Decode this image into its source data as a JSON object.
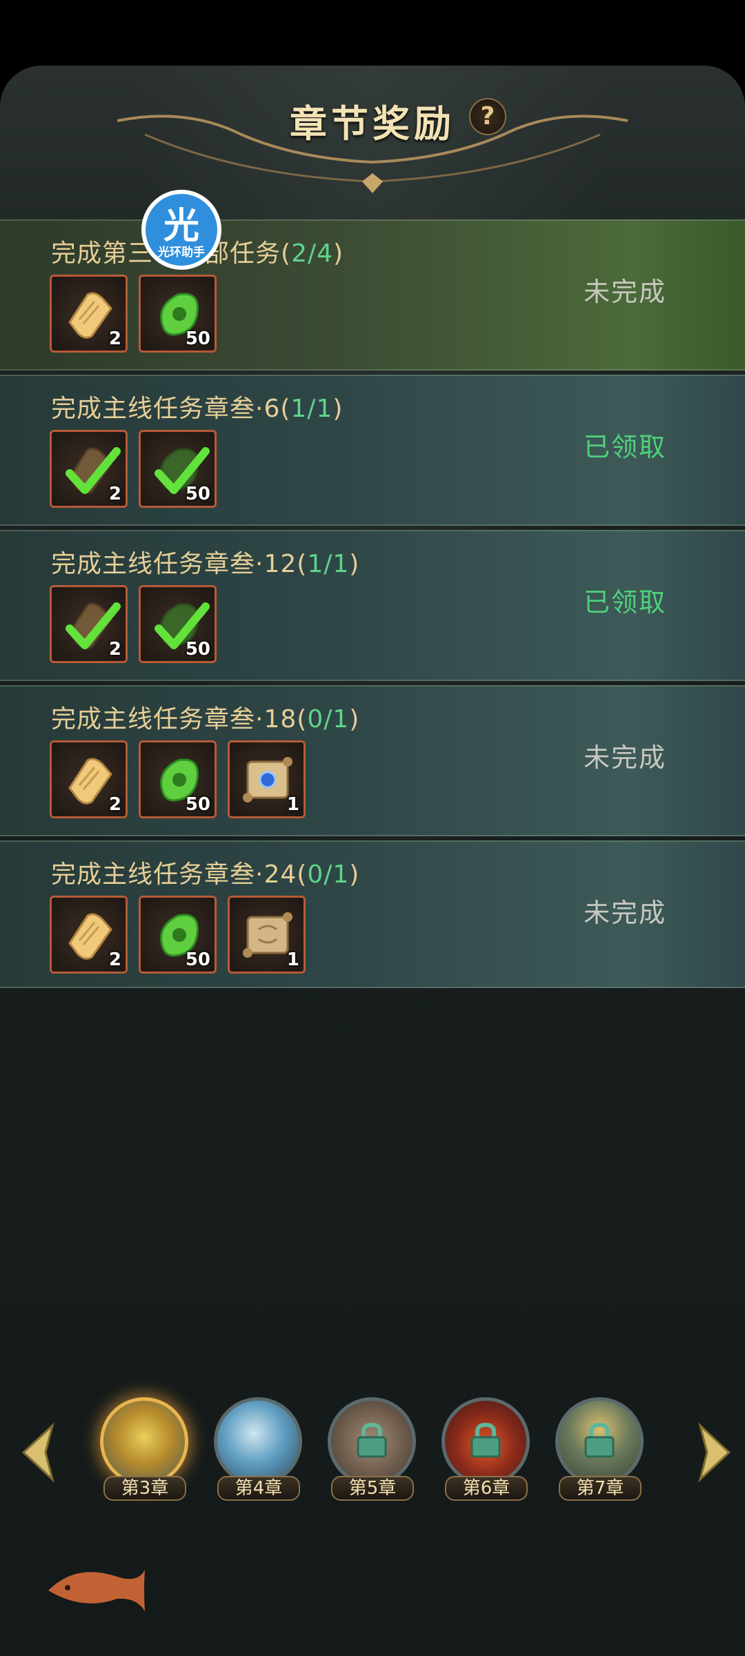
{
  "header": {
    "title": "章节奖励",
    "help_label": "?"
  },
  "assistant_badge": {
    "char": "光",
    "label": "光环助手"
  },
  "tasks": [
    {
      "prefix": "完成第三",
      "hidden": "章全",
      "suffix": "部任务(",
      "progress": "2/4",
      "close": ")",
      "status": "未完成",
      "claimed": false,
      "items": [
        {
          "icon": "ticket-icon",
          "qty": "2"
        },
        {
          "icon": "jade-icon",
          "qty": "50"
        }
      ]
    },
    {
      "prefix": "完成主线任务章叁·6(",
      "progress": "1/1",
      "close": ")",
      "status": "已领取",
      "claimed": true,
      "items": [
        {
          "icon": "ticket-icon",
          "qty": "2"
        },
        {
          "icon": "jade-icon",
          "qty": "50"
        }
      ]
    },
    {
      "prefix": "完成主线任务章叁·12(",
      "progress": "1/1",
      "close": ")",
      "status": "已领取",
      "claimed": true,
      "items": [
        {
          "icon": "ticket-icon",
          "qty": "2"
        },
        {
          "icon": "jade-icon",
          "qty": "50"
        }
      ]
    },
    {
      "prefix": "完成主线任务章叁·18(",
      "progress": "0/1",
      "close": ")",
      "status": "未完成",
      "claimed": false,
      "items": [
        {
          "icon": "ticket-icon",
          "qty": "2"
        },
        {
          "icon": "jade-icon",
          "qty": "50"
        },
        {
          "icon": "blue-scroll-icon",
          "qty": "1"
        }
      ]
    },
    {
      "prefix": "完成主线任务章叁·24(",
      "progress": "0/1",
      "close": ")",
      "status": "未完成",
      "claimed": false,
      "items": [
        {
          "icon": "ticket-icon",
          "qty": "2"
        },
        {
          "icon": "jade-icon",
          "qty": "50"
        },
        {
          "icon": "scroll-icon",
          "qty": "1"
        }
      ]
    }
  ],
  "chapters": [
    {
      "label": "第3章",
      "active": true,
      "locked": false
    },
    {
      "label": "第4章",
      "active": false,
      "locked": false
    },
    {
      "label": "第5章",
      "active": false,
      "locked": true
    },
    {
      "label": "第6章",
      "active": false,
      "locked": true
    },
    {
      "label": "第7章",
      "active": false,
      "locked": true
    }
  ],
  "colors": {
    "gold_text": "#e6cf98",
    "progress_green": "#5fd48a",
    "claimed_green": "#4fd07c",
    "pending_gray": "#c8c8c0",
    "item_border": "#b85a36"
  }
}
